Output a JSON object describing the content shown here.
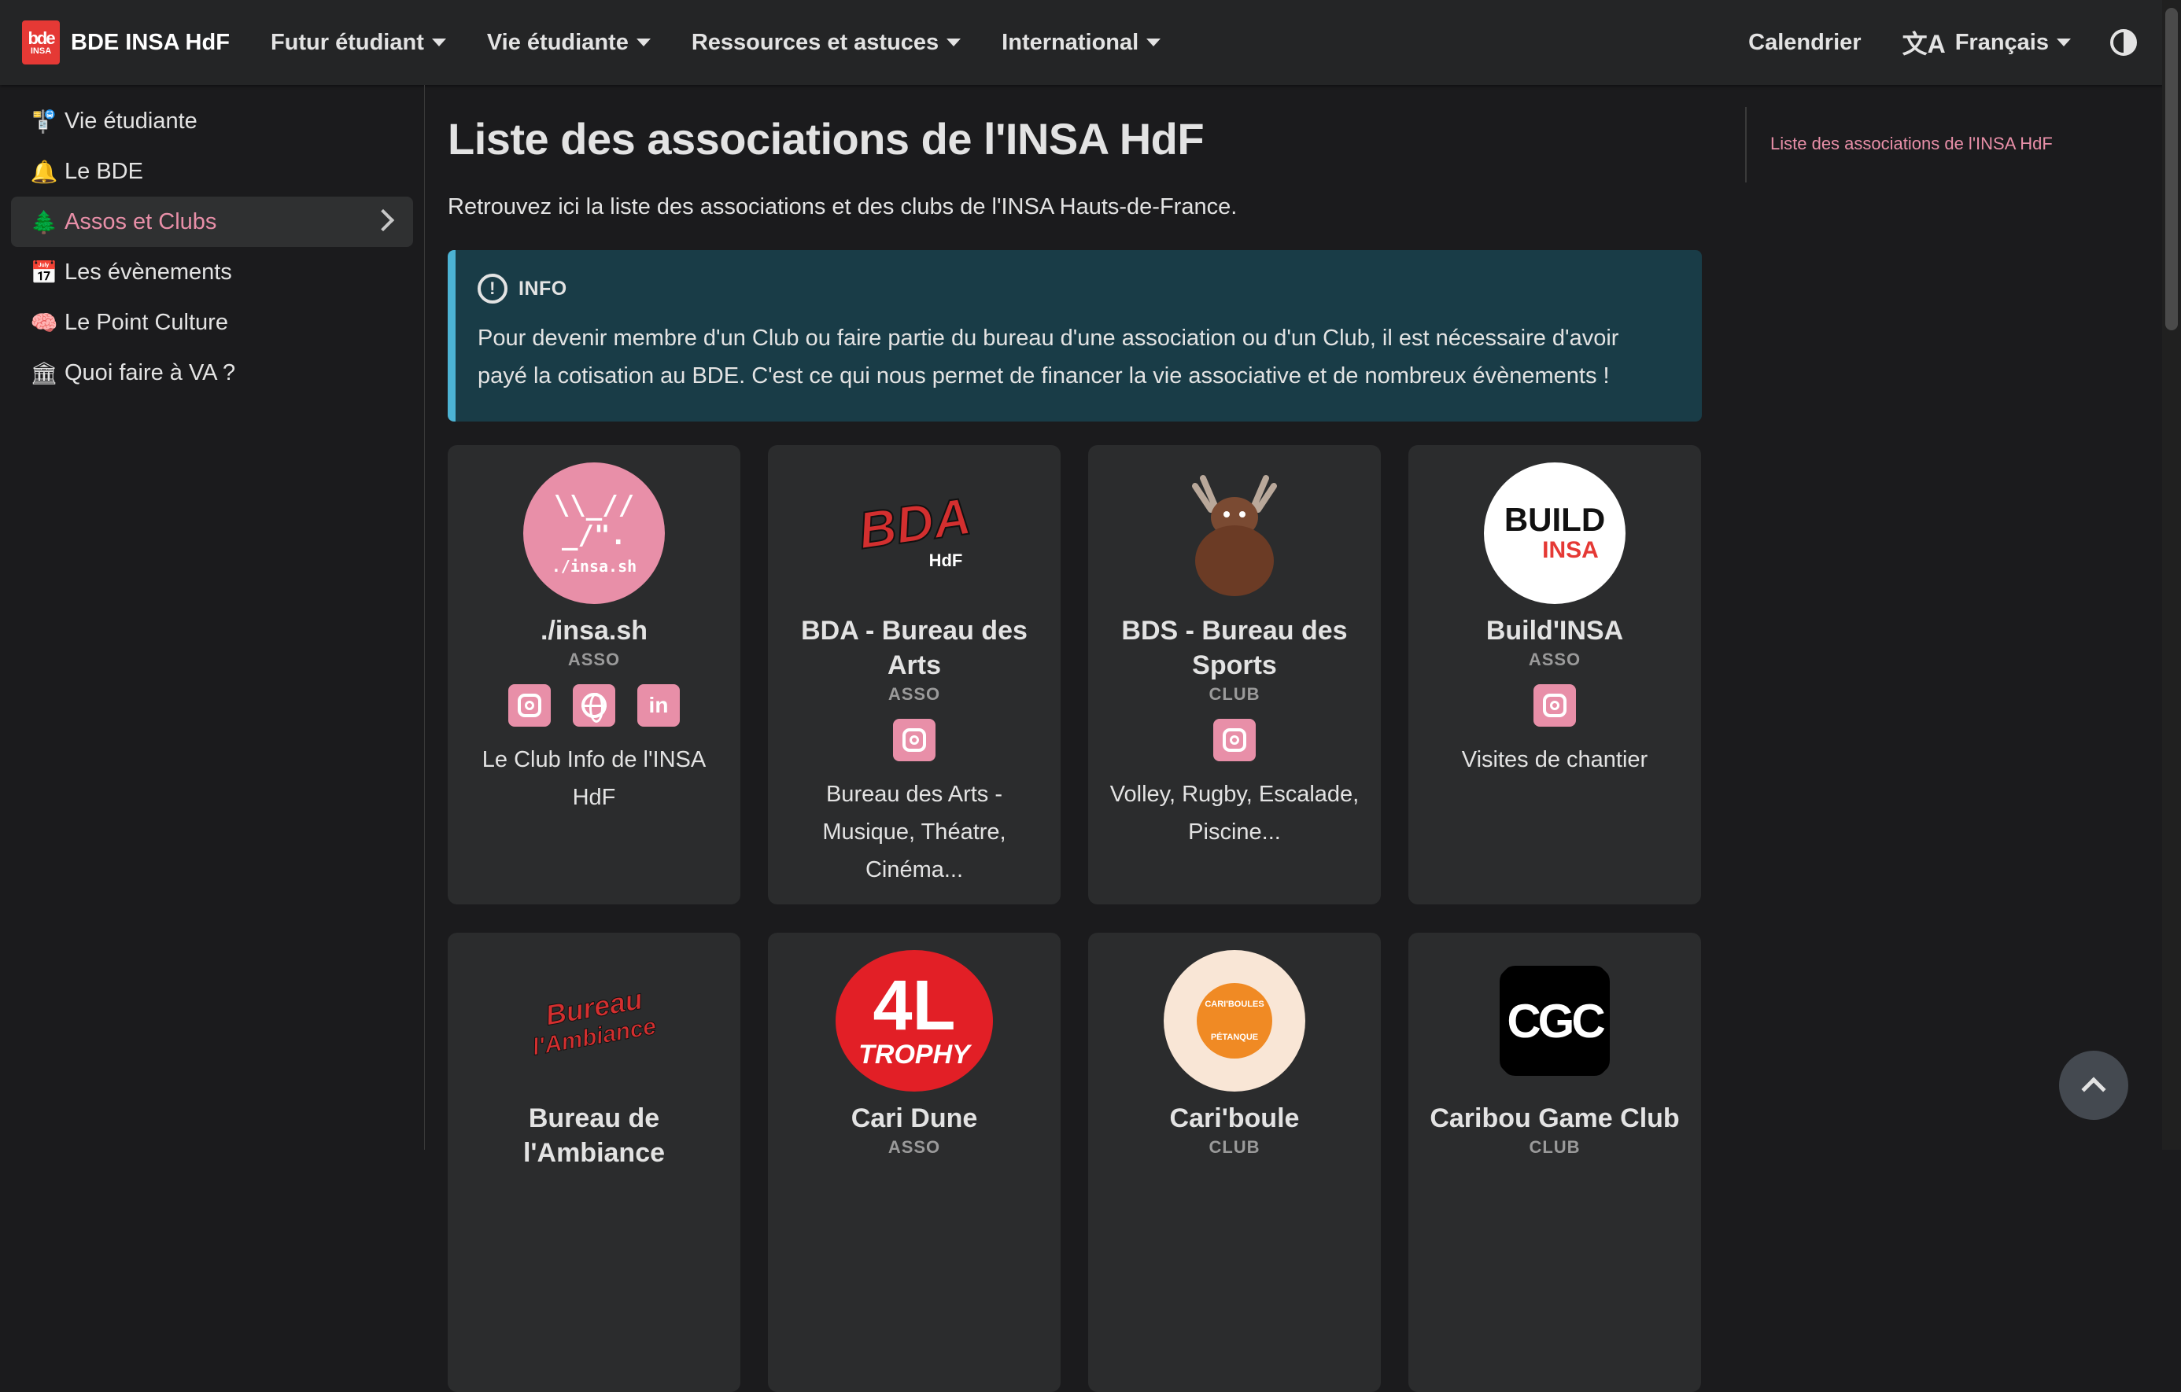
{
  "navbar": {
    "logo_top": "bde",
    "logo_bottom": "INSA",
    "title": "BDE INSA HdF",
    "items": [
      "Futur étudiant",
      "Vie étudiante",
      "Ressources et astuces",
      "International"
    ],
    "calendar": "Calendrier",
    "language": "Français",
    "lang_icon": "translate-icon",
    "theme_icon": "contrast-icon"
  },
  "sidebar": {
    "items": [
      {
        "icon": "🚏",
        "label": "Vie étudiante"
      },
      {
        "icon": "🔔",
        "label": "Le BDE"
      },
      {
        "icon": "🌲",
        "label": "Assos et Clubs",
        "active": true
      },
      {
        "icon": "📅",
        "label": "Les évènements"
      },
      {
        "icon": "🧠",
        "label": "Le Point Culture"
      },
      {
        "icon": "🏛",
        "label": "Quoi faire à VA ?"
      }
    ]
  },
  "main": {
    "title": "Liste des associations de l'INSA HdF",
    "intro": "Retrouvez ici la liste des associations et des clubs de l'INSA Hauts-de-France.",
    "admonition": {
      "label": "INFO",
      "text": "Pour devenir membre d'un Club ou faire partie du bureau d'une association ou d'un Club, il est nécessaire d'avoir payé la cotisation au BDE. C'est ce qui nous permet de financer la vie associative et de nombreux évènements !"
    },
    "cards": [
      {
        "name": "./insa.sh",
        "type": "ASSO",
        "desc": "Le Club Info de l'INSA HdF",
        "logo_l1": "\\\\_//",
        "logo_l2": "_/\".",
        "logo_l3": "./insa.sh"
      },
      {
        "name": "BDA - Bureau des Arts",
        "type": "ASSO",
        "desc": "Bureau des Arts - Musique, Théatre, Cinéma...",
        "logo_l1": "BDA",
        "logo_l2": "HdF"
      },
      {
        "name": "BDS - Bureau des Sports",
        "type": "CLUB",
        "desc": "Volley, Rugby, Escalade, Piscine..."
      },
      {
        "name": "Build'INSA",
        "type": "ASSO",
        "desc": "Visites de chantier",
        "logo_l1": "BUILD",
        "logo_l2": "INSA"
      },
      {
        "name": "Bureau de l'Ambiance",
        "type": "",
        "desc": "",
        "logo_l1": "Bureau",
        "logo_l2": "l'Ambiance"
      },
      {
        "name": "Cari Dune",
        "type": "ASSO",
        "desc": "",
        "logo_l1": "4L",
        "logo_l2": "TROPHY"
      },
      {
        "name": "Cari'boule",
        "type": "CLUB",
        "desc": "",
        "logo_l1": "CARI'BOULES",
        "logo_l2": "PÉTANQUE"
      },
      {
        "name": "Caribou Game Club",
        "type": "CLUB",
        "desc": "",
        "logo_l1": "CGC"
      }
    ]
  },
  "toc": {
    "link": "Liste des associations de l'INSA HdF"
  },
  "colors": {
    "accent": "#e88fa8",
    "background": "#1b1b1d",
    "navbar": "#242526",
    "info_bg": "#193c47",
    "info_border": "#4cb3d4"
  }
}
